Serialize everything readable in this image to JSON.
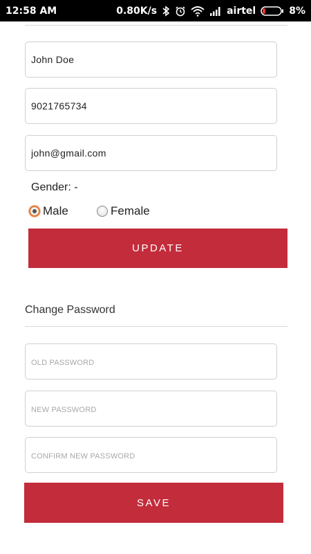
{
  "status_bar": {
    "time": "12:58 AM",
    "speed": "0.80K/s",
    "carrier": "airtel",
    "battery": "8%",
    "icons": [
      "bluetooth-icon",
      "alarm-icon",
      "wifi-icon",
      "signal-icon",
      "battery-icon"
    ],
    "battery_color": "#e53935"
  },
  "profile": {
    "name": "John Doe",
    "phone": "9021765734",
    "email": "john@gmail.com",
    "gender_label": "Gender: -",
    "gender_options": [
      "Male",
      "Female"
    ],
    "gender_selected": "Male",
    "update_label": "UPDATE"
  },
  "password": {
    "title": "Change Password",
    "old_placeholder": "OLD PASSWORD",
    "new_placeholder": "NEW PASSWORD",
    "confirm_placeholder": "CONFIRM NEW PASSWORD",
    "save_label": "SAVE"
  },
  "colors": {
    "accent": "#c32c3b",
    "radio_focus": "#e6742e"
  }
}
